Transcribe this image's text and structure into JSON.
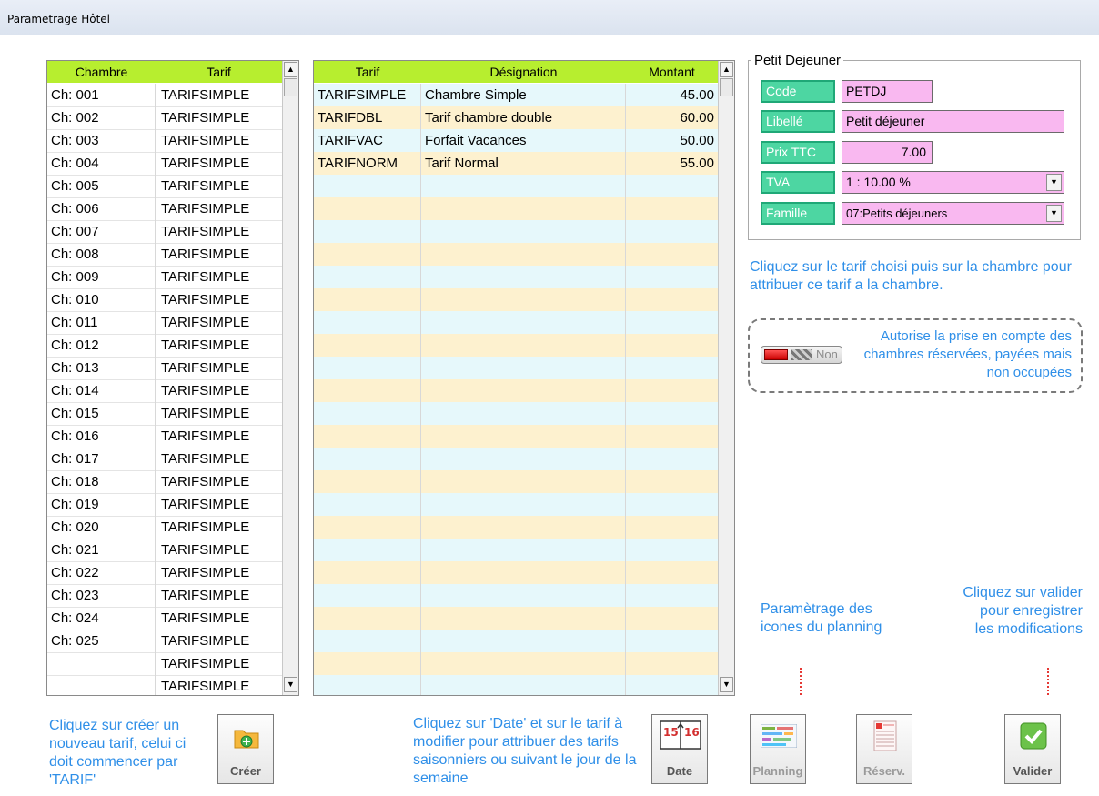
{
  "window": {
    "title": "Parametrage Hôtel"
  },
  "rooms_grid": {
    "headers": [
      "Chambre",
      "Tarif"
    ],
    "rows": [
      [
        "Ch: 001",
        "TARIFSIMPLE"
      ],
      [
        "Ch: 002",
        "TARIFSIMPLE"
      ],
      [
        "Ch: 003",
        "TARIFSIMPLE"
      ],
      [
        "Ch: 004",
        "TARIFSIMPLE"
      ],
      [
        "Ch: 005",
        "TARIFSIMPLE"
      ],
      [
        "Ch: 006",
        "TARIFSIMPLE"
      ],
      [
        "Ch: 007",
        "TARIFSIMPLE"
      ],
      [
        "Ch: 008",
        "TARIFSIMPLE"
      ],
      [
        "Ch: 009",
        "TARIFSIMPLE"
      ],
      [
        "Ch: 010",
        "TARIFSIMPLE"
      ],
      [
        "Ch: 011",
        "TARIFSIMPLE"
      ],
      [
        "Ch: 012",
        "TARIFSIMPLE"
      ],
      [
        "Ch: 013",
        "TARIFSIMPLE"
      ],
      [
        "Ch: 014",
        "TARIFSIMPLE"
      ],
      [
        "Ch: 015",
        "TARIFSIMPLE"
      ],
      [
        "Ch: 016",
        "TARIFSIMPLE"
      ],
      [
        "Ch: 017",
        "TARIFSIMPLE"
      ],
      [
        "Ch: 018",
        "TARIFSIMPLE"
      ],
      [
        "Ch: 019",
        "TARIFSIMPLE"
      ],
      [
        "Ch: 020",
        "TARIFSIMPLE"
      ],
      [
        "Ch: 021",
        "TARIFSIMPLE"
      ],
      [
        "Ch: 022",
        "TARIFSIMPLE"
      ],
      [
        "Ch: 023",
        "TARIFSIMPLE"
      ],
      [
        "Ch: 024",
        "TARIFSIMPLE"
      ],
      [
        "Ch: 025",
        "TARIFSIMPLE"
      ],
      [
        "",
        "TARIFSIMPLE"
      ],
      [
        "",
        "TARIFSIMPLE"
      ]
    ]
  },
  "tarifs_grid": {
    "headers": [
      "Tarif",
      "Désignation",
      "Montant"
    ],
    "rows": [
      [
        "TARIFSIMPLE",
        "Chambre Simple",
        "45.00"
      ],
      [
        "TARIFDBL",
        "Tarif chambre double",
        "60.00"
      ],
      [
        "TARIFVAC",
        "Forfait Vacances",
        "50.00"
      ],
      [
        "TARIFNORM",
        "Tarif Normal",
        "55.00"
      ]
    ],
    "empty_rows": 23
  },
  "petit_dejeuner": {
    "legend": "Petit Dejeuner",
    "code_label": "Code",
    "code_value": "PETDJ",
    "libelle_label": "Libellé",
    "libelle_value": "Petit déjeuner",
    "prix_label": "Prix TTC",
    "prix_value": "7.00",
    "tva_label": "TVA",
    "tva_value": "1 : 10.00 %",
    "famille_label": "Famille",
    "famille_value": "07:Petits déjeuners"
  },
  "help": {
    "tarif_chambre": "Cliquez sur le tarif choisi puis sur la chambre pour attribuer ce tarif a la chambre.",
    "autorise": "Autorise la prise en compte des chambres réservées, payées mais non occupées",
    "toggle_state": "Non",
    "planning": "Paramètrage des icones du planning",
    "valider": "Cliquez sur valider pour enregistrer les modifications",
    "creer": "Cliquez sur créer un nouveau tarif, celui ci doit commencer par 'TARIF'",
    "date": "Cliquez sur 'Date' et sur le tarif à modifier pour attribuer des tarifs saisonniers ou suivant le jour de la semaine"
  },
  "buttons": {
    "creer": "Créer",
    "date": "Date",
    "date_icon_left": "15",
    "date_icon_right": "16",
    "planning": "Planning",
    "reserv": "Réserv.",
    "valider": "Valider"
  },
  "colors": {
    "header_green": "#b7ee2f",
    "row_cyan": "#e6f8fb",
    "row_yellow": "#fdf1cf",
    "label_green": "#4dd6a2",
    "value_pink": "#f9b8f0",
    "help_blue": "#2f8fe8"
  }
}
